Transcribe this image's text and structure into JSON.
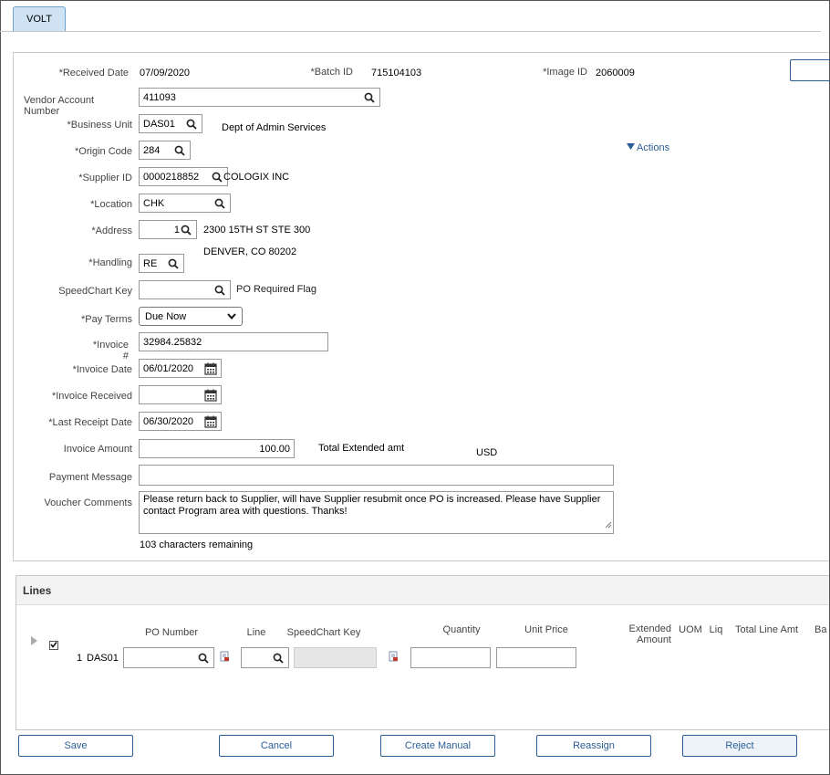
{
  "tab": {
    "label": "VOLT"
  },
  "header": {
    "received_date_label": "*Received Date",
    "received_date": "07/09/2020",
    "batch_id_label": "*Batch ID",
    "batch_id": "715104103",
    "image_id_label": "*Image ID",
    "image_id": "2060009"
  },
  "form": {
    "vendor_account_label": "Vendor Account Number",
    "vendor_account": "411093",
    "business_unit_label": "*Business Unit",
    "business_unit": "DAS01",
    "business_unit_desc": "Dept of Admin Services",
    "origin_code_label": "*Origin Code",
    "origin_code": "284",
    "actions_label": "Actions",
    "supplier_id_label": "*Supplier ID",
    "supplier_id": "0000218852",
    "supplier_name": "COLOGIX INC",
    "location_label": "*Location",
    "location": "CHK",
    "address_label": "*Address",
    "address": "1",
    "address_line1": "2300 15TH ST STE 300",
    "address_line2": "DENVER, CO  80202",
    "handling_label": "*Handling",
    "handling": "RE",
    "speedchart_label": "SpeedChart Key",
    "speedchart": "",
    "po_required_flag": "PO Required Flag",
    "pay_terms_label": "*Pay Terms",
    "pay_terms": "Due Now",
    "invoice_label": "*Invoice #",
    "invoice": "32984.25832",
    "invoice_date_label": "*Invoice Date",
    "invoice_date": "06/01/2020",
    "invoice_received_label": "*Invoice Received",
    "invoice_received": "",
    "last_receipt_label": "*Last Receipt Date",
    "last_receipt": "06/30/2020",
    "invoice_amount_label": "Invoice Amount",
    "invoice_amount": "100.00",
    "total_extended_label": "Total Extended amt",
    "currency": "USD",
    "payment_message_label": "Payment Message",
    "payment_message": "",
    "voucher_comments_label": "Voucher Comments",
    "voucher_comments": "Please return back to Supplier, will have Supplier resubmit once PO is increased. Please have Supplier contact Program area with questions. Thanks!",
    "chars_remaining": "103 characters remaining"
  },
  "lines": {
    "title": "Lines",
    "columns": {
      "po_number": "PO Number",
      "line": "Line",
      "speedchart_key": "SpeedChart Key",
      "quantity": "Quantity",
      "unit_price": "Unit Price",
      "extended_amount": "Extended Amount",
      "uom": "UOM",
      "liq": "Liq",
      "total_line_amt": "Total Line Amt",
      "ba": "Ba"
    },
    "rows": [
      {
        "num": "1",
        "bu": "DAS01"
      }
    ]
  },
  "buttons": {
    "save": "Save",
    "cancel": "Cancel",
    "create_manual": "Create Manual",
    "reassign": "Reassign",
    "reject": "Reject"
  }
}
